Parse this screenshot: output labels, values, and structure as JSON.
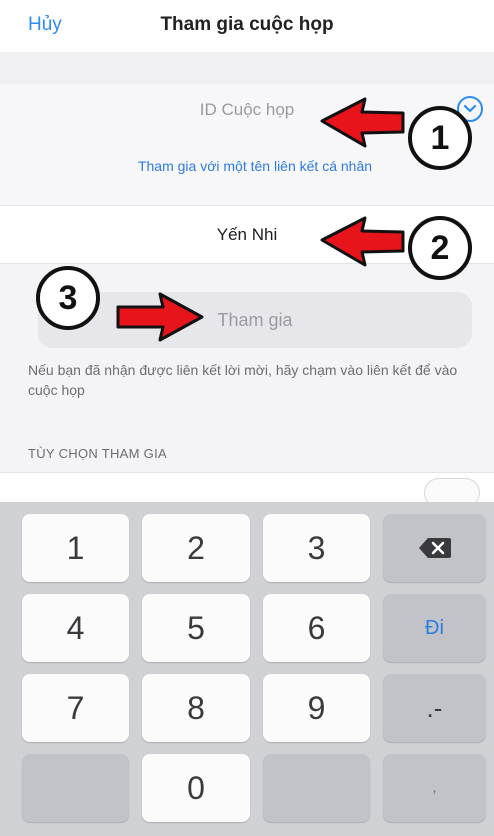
{
  "header": {
    "cancel_label": "Hủy",
    "title": "Tham gia cuộc họp"
  },
  "meeting_id": {
    "placeholder": "ID Cuộc họp",
    "value": ""
  },
  "personal_link_label": "Tham gia với một tên liên kết cá nhân",
  "display_name": {
    "value": "Yến Nhi"
  },
  "join_button_label": "Tham gia",
  "hint_text": "Nếu bạn đã nhận được liên kết lời mời, hãy chạm vào liên kết để vào cuộc họp",
  "options_header": "TÙY CHỌN THAM GIA",
  "keyboard": {
    "keys": [
      "1",
      "2",
      "3",
      "⌫",
      "4",
      "5",
      "6",
      "Đi",
      "7",
      "8",
      "9",
      ".-",
      "",
      "0",
      "",
      ","
    ]
  },
  "annotations": {
    "step1": "1",
    "step2": "2",
    "step3": "3"
  },
  "colors": {
    "accent": "#2d8cf0",
    "annotation_arrow": "#e8141b"
  }
}
